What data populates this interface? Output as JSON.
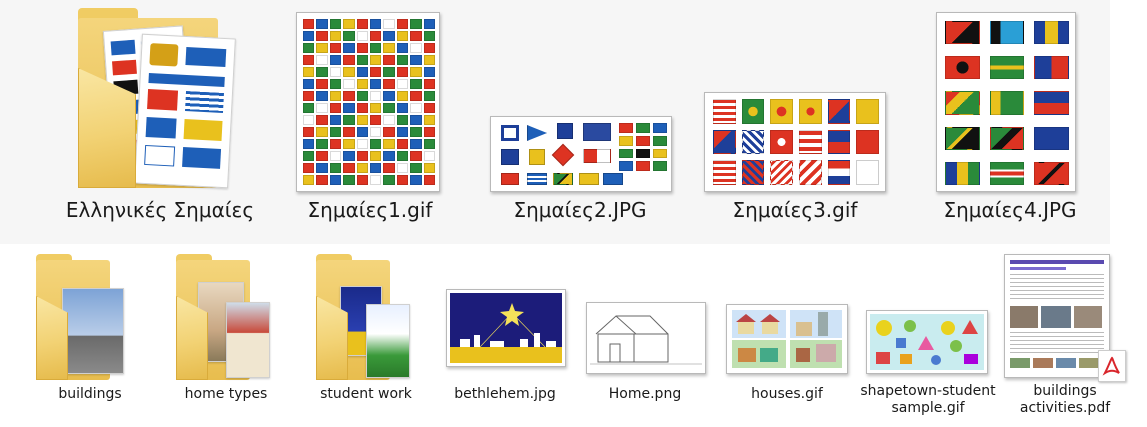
{
  "top_row": [
    {
      "name": "Ελληνικές Σημαίες",
      "type": "folder",
      "icon": "folder-icon"
    },
    {
      "name": "Σημαίες1.gif",
      "type": "image",
      "icon": "flags-image-icon"
    },
    {
      "name": "Σημαίες2.JPG",
      "type": "image",
      "icon": "flags-image-icon"
    },
    {
      "name": "Σημαίες3.gif",
      "type": "image",
      "icon": "flags-image-icon"
    },
    {
      "name": "Σημαίες4.JPG",
      "type": "image",
      "icon": "flags-image-icon"
    }
  ],
  "bottom_row": [
    {
      "name": "buildings",
      "type": "folder",
      "icon": "folder-icon"
    },
    {
      "name": "home types",
      "type": "folder",
      "icon": "folder-icon"
    },
    {
      "name": "student work",
      "type": "folder",
      "icon": "folder-icon"
    },
    {
      "name": "bethlehem.jpg",
      "type": "image",
      "icon": "image-thumbnail-icon"
    },
    {
      "name": "Home.png",
      "type": "image",
      "icon": "image-thumbnail-icon"
    },
    {
      "name": "houses.gif",
      "type": "image",
      "icon": "image-thumbnail-icon"
    },
    {
      "name": "shapetown-student sample.gif",
      "type": "image",
      "icon": "image-thumbnail-icon"
    },
    {
      "name": "buildings activities.pdf",
      "type": "pdf",
      "icon": "pdf-icon"
    }
  ],
  "colors": {
    "folder": "#f2d274",
    "pdf_badge": "#d9262c",
    "label_text": "#1a1a1a"
  }
}
